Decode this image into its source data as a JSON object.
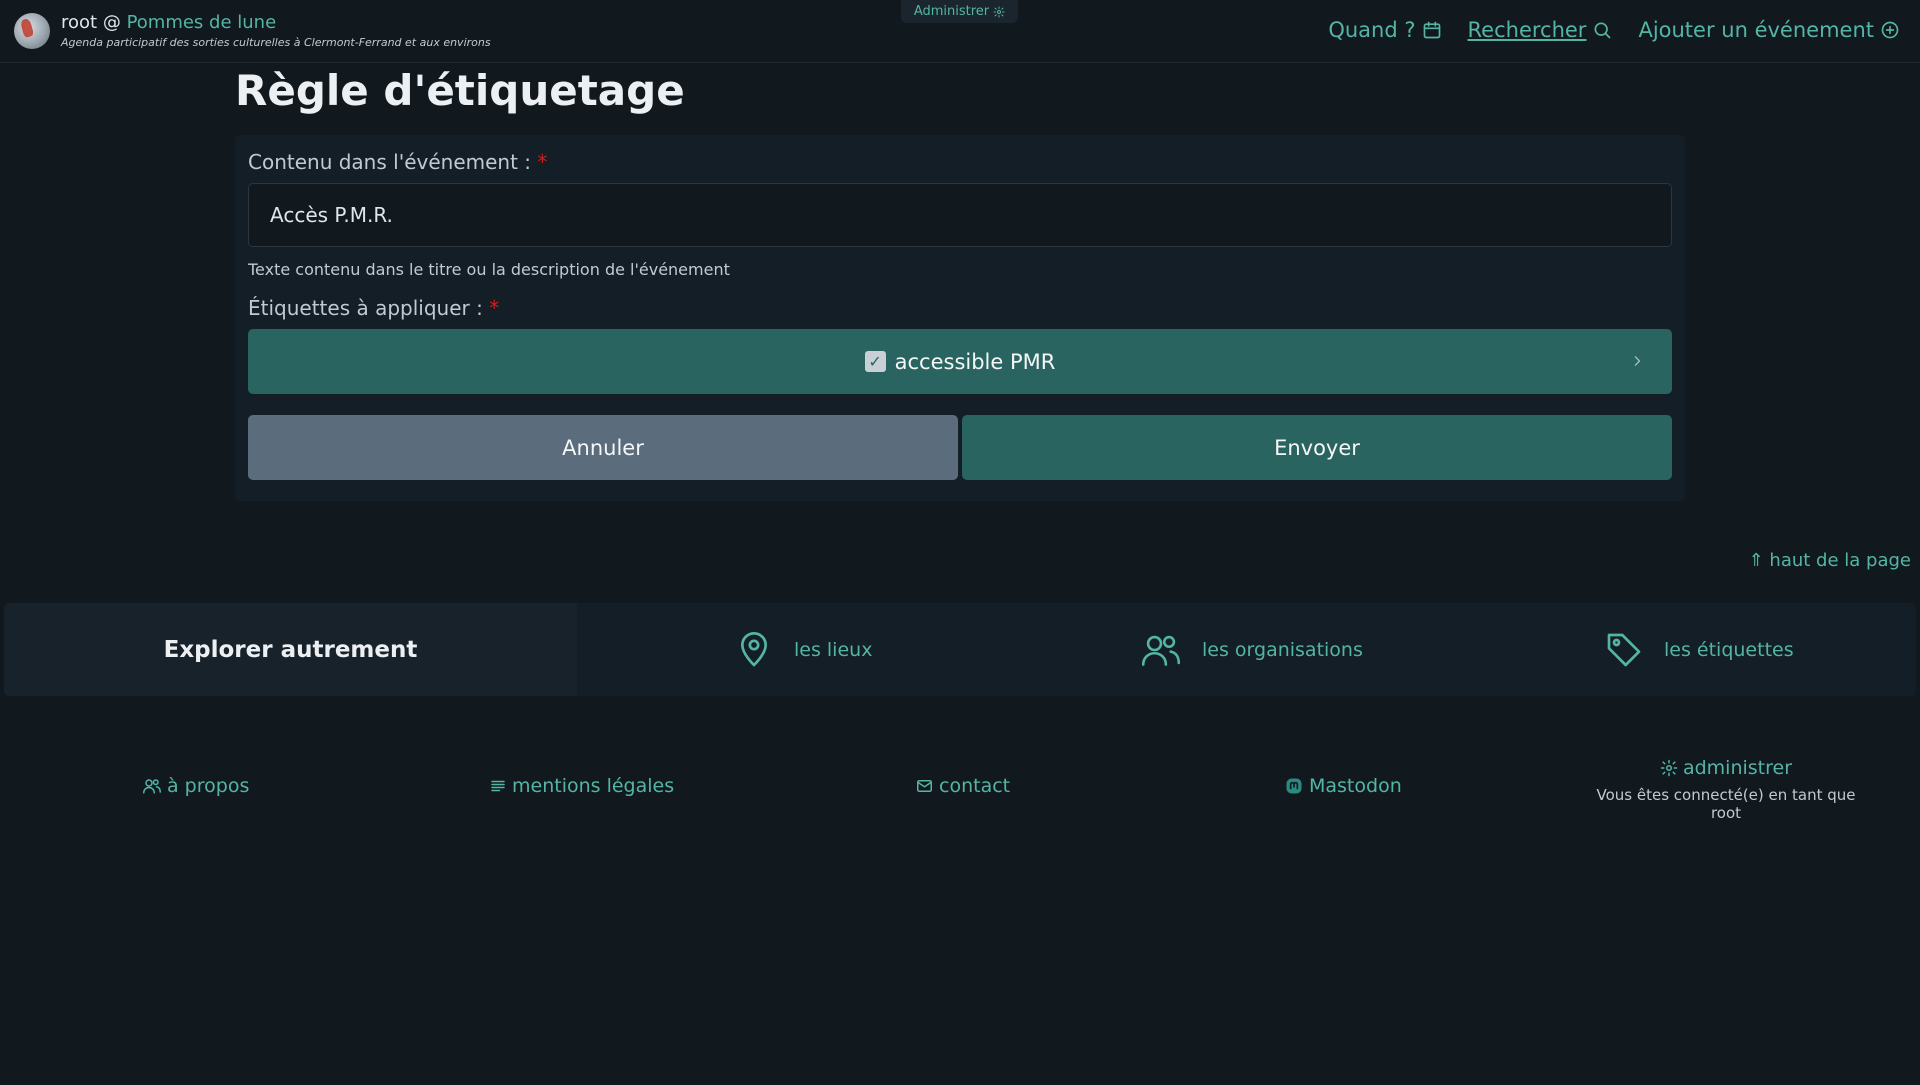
{
  "header": {
    "user": "root",
    "separator": "@",
    "site_name": "Pommes de lune",
    "tagline": "Agenda participatif des sorties culturelles à Clermont-Ferrand et aux environs",
    "admin_pill": "Administrer",
    "nav": {
      "when": "Quand ?",
      "search": "Rechercher",
      "add_event": "Ajouter un événement"
    }
  },
  "page": {
    "title": "Règle d'étiquetage"
  },
  "form": {
    "content_label": "Contenu dans l'événement :",
    "required_marker": "*",
    "content_value": "Accès P.M.R.",
    "content_help": "Texte contenu dans le titre ou la description de l'événement",
    "tags_label": "Étiquettes à appliquer :",
    "selected_tag": "accessible PMR",
    "cancel_label": "Annuler",
    "submit_label": "Envoyer"
  },
  "back_to_top": "⇑ haut de la page",
  "explore": {
    "title": "Explorer autrement",
    "places": "les lieux",
    "organisations": "les organisations",
    "tags": "les étiquettes"
  },
  "footer": {
    "about": "à propos",
    "legal": "mentions légales",
    "contact": "contact",
    "mastodon": "Mastodon",
    "admin": "administrer",
    "logged_in": "Vous êtes connecté(e) en tant que root"
  },
  "colors": {
    "background": "#11191f",
    "accent": "#54b5a5",
    "primary_button": "#2a6460",
    "secondary_button": "#5b6d7c",
    "required": "#d81b1b"
  }
}
